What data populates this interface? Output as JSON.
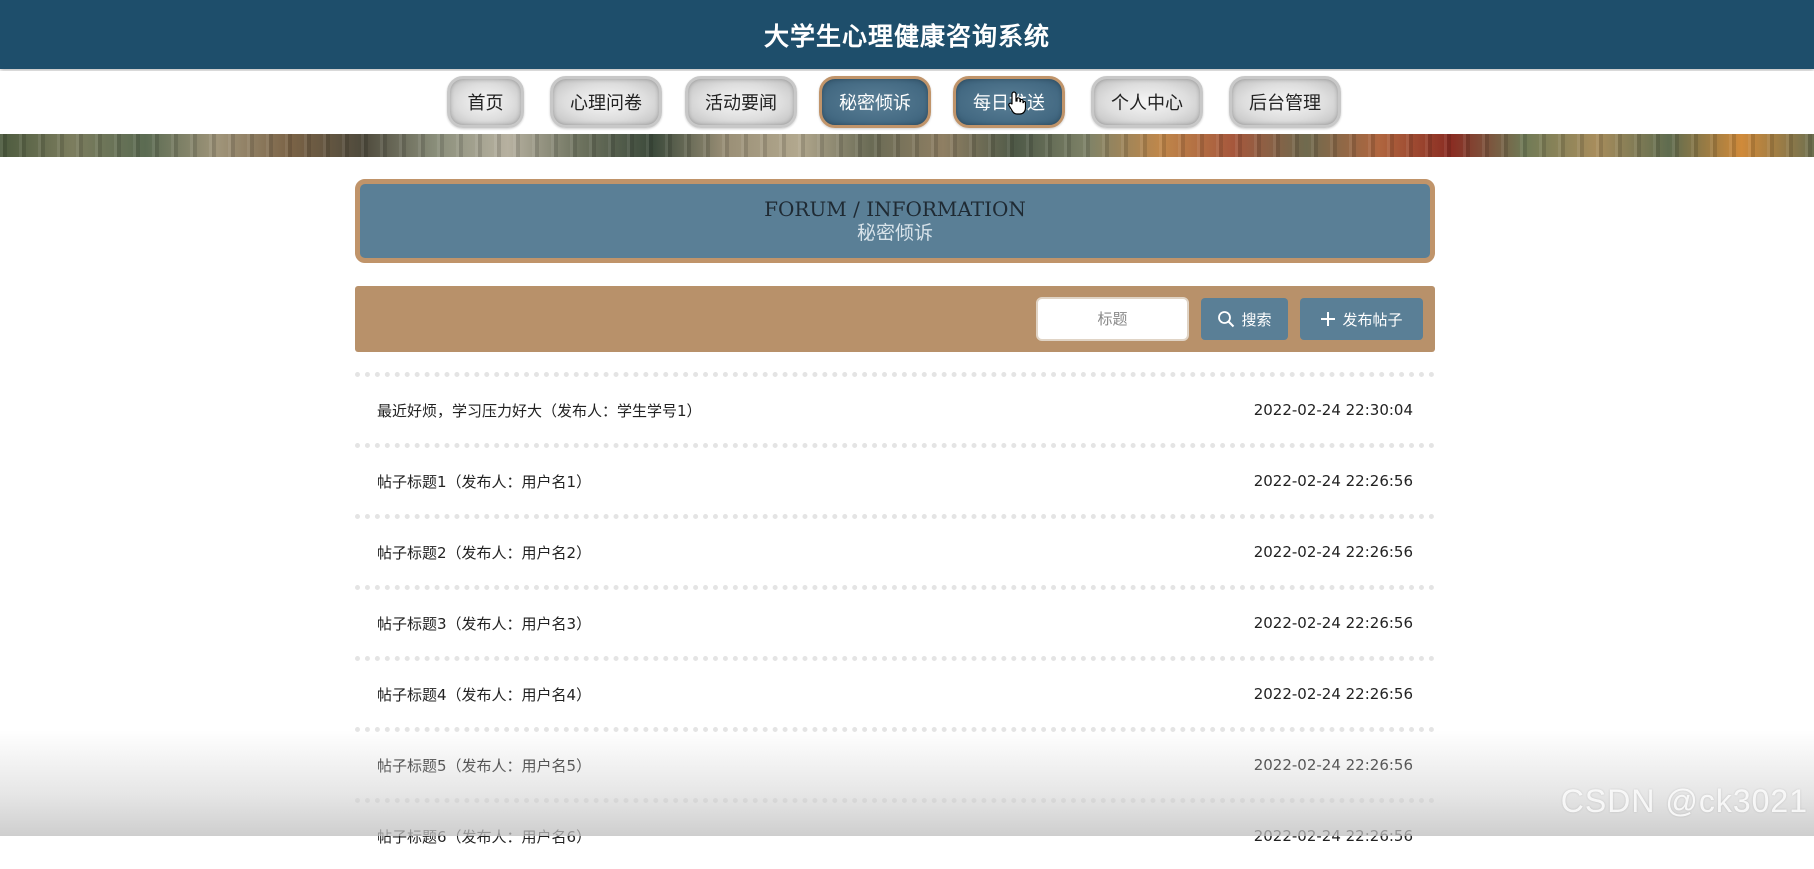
{
  "header": {
    "title": "大学生心理健康咨询系统"
  },
  "nav": {
    "items": [
      {
        "label": "首页",
        "active": false
      },
      {
        "label": "心理问卷",
        "active": false
      },
      {
        "label": "活动要闻",
        "active": false
      },
      {
        "label": "秘密倾诉",
        "active": true
      },
      {
        "label": "每日推送",
        "active": true
      },
      {
        "label": "个人中心",
        "active": false
      },
      {
        "label": "后台管理",
        "active": false
      }
    ]
  },
  "page_title": {
    "en": "FORUM / INFORMATION",
    "cn": "秘密倾诉"
  },
  "toolbar": {
    "search_placeholder": "标题",
    "search_label": "搜索",
    "post_label": "发布帖子"
  },
  "posts": [
    {
      "title": "最近好烦，学习压力好大（发布人：学生学号1）",
      "time": "2022-02-24 22:30:04"
    },
    {
      "title": "帖子标题1（发布人：用户名1）",
      "time": "2022-02-24 22:26:56"
    },
    {
      "title": "帖子标题2（发布人：用户名2）",
      "time": "2022-02-24 22:26:56"
    },
    {
      "title": "帖子标题3（发布人：用户名3）",
      "time": "2022-02-24 22:26:56"
    },
    {
      "title": "帖子标题4（发布人：用户名4）",
      "time": "2022-02-24 22:26:56"
    },
    {
      "title": "帖子标题5（发布人：用户名5）",
      "time": "2022-02-24 22:26:56"
    },
    {
      "title": "帖子标题6（发布人：用户名6）",
      "time": "2022-02-24 22:26:56"
    }
  ],
  "watermark": "CSDN @ck3021",
  "colors": {
    "header_bg": "#1e4e6b",
    "accent_blue": "#5a7f96",
    "accent_tan": "#b8916a",
    "border_tan": "#c0946a"
  }
}
